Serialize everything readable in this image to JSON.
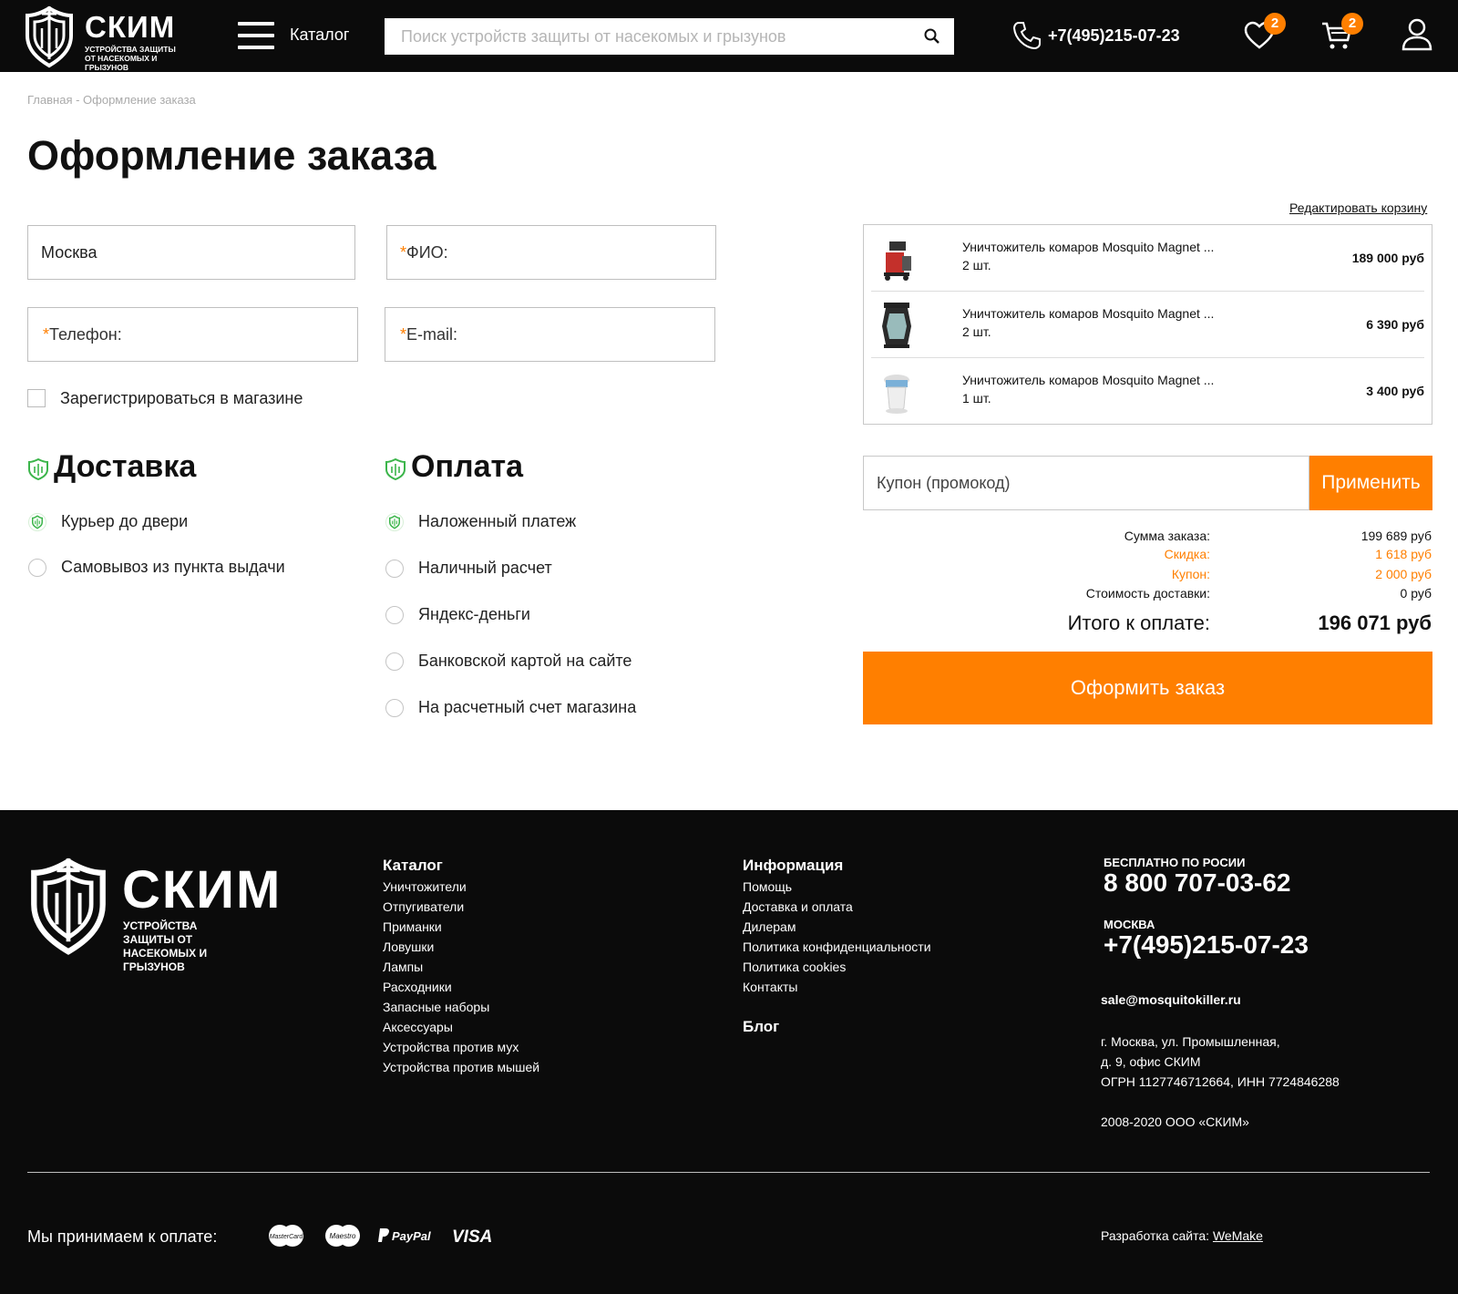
{
  "header": {
    "logo_title": "СКИМ",
    "logo_subtitle": "УСТРОЙСТВА ЗАЩИТЫ ОТ НАСЕКОМЫХ И ГРЫЗУНОВ",
    "catalog_label": "Каталог",
    "search_placeholder": "Поиск устройств защиты от насекомых и грызунов",
    "phone": "+7(495)215-07-23",
    "favorites_count": "2",
    "cart_count": "2"
  },
  "breadcrumb": "Главная - Оформление заказа",
  "page_title": "Оформление заказа",
  "form": {
    "city_value": "Москва",
    "fio_label": "ФИО:",
    "phone_label": "Телефон:",
    "email_label": "E-mail:",
    "required_mark": "*",
    "register_label": "Зарегистрироваться в магазине"
  },
  "delivery": {
    "title": "Доставка",
    "options": [
      "Курьер до двери",
      "Самовывоз из пункта выдачи"
    ],
    "selected": 0
  },
  "payment": {
    "title": "Оплата",
    "options": [
      "Наложенный платеж",
      "Наличный расчет",
      "Яндекс-деньги",
      "Банковской картой на сайте",
      "На расчетный счет магазина"
    ],
    "selected": 0
  },
  "cart": {
    "edit_label": "Редактировать корзину",
    "items": [
      {
        "name": "Уничтожитель комаров Mosquito Magnet ...",
        "qty": "2 шт.",
        "price": "189 000 руб"
      },
      {
        "name": "Уничтожитель комаров Mosquito Magnet ...",
        "qty": "2 шт.",
        "price": "6 390 руб"
      },
      {
        "name": "Уничтожитель комаров Mosquito Magnet ...",
        "qty": "1 шт.",
        "price": "3 400 руб"
      }
    ]
  },
  "coupon": {
    "placeholder": "Купон (промокод)",
    "apply_label": "Применить"
  },
  "summary": {
    "order_sum_label": "Сумма заказа:",
    "order_sum_value": "199 689  руб",
    "discount_label": "Скидка:",
    "discount_value": "1 618 руб",
    "coupon_label": "Купон:",
    "coupon_value": "2 000 руб",
    "delivery_label": "Стоимость доставки:",
    "delivery_value": "0  руб",
    "total_label": "Итого к оплате:",
    "total_value": "196 071 руб",
    "submit_label": "Оформить заказ"
  },
  "footer": {
    "logo_title": "СКИМ",
    "logo_subtitle": "УСТРОЙСТВА ЗАЩИТЫ ОТ НАСЕКОМЫХ И ГРЫЗУНОВ",
    "catalog_title": "Каталог",
    "catalog_links": [
      "Уничтожители",
      "Отпугиватели",
      "Приманки",
      "Ловушки",
      "Лампы",
      "Расходники",
      "Запасные наборы",
      "Аксессуары",
      "Устройства против мух",
      "Устройства против мышей"
    ],
    "info_title": "Информация",
    "info_links": [
      "Помощь",
      "Доставка и оплата",
      "Дилерам",
      "Политика конфиденциальности",
      "Политика cookies",
      "Контакты"
    ],
    "blog_title": "Блог",
    "free_label": "БЕСПЛАТНО ПО РОСИИ",
    "free_phone": "8 800 707-03-62",
    "moscow_label": "МОСКВА",
    "moscow_phone": "+7(495)215-07-23",
    "email": "sale@mosquitokiller.ru",
    "address_1": "г. Москва, ул. Промышленная,",
    "address_2": "д. 9, офис СКИМ",
    "legal": "ОГРН 1127746712664, ИНН 7724846288",
    "copyright": "2008-2020 ООО «СКИМ»",
    "pay_label": "Мы принимаем к оплате:",
    "pay_mastercard": "MasterCard",
    "pay_maestro": "Maestro",
    "pay_paypal": "PayPal",
    "pay_visa": "VISA",
    "dev_label": "Разработка сайта:",
    "dev_link": "WeMake"
  },
  "colors": {
    "accent": "#ff7f00",
    "header_bg": "#0b0b0b",
    "shield_green": "#3bb54a"
  }
}
